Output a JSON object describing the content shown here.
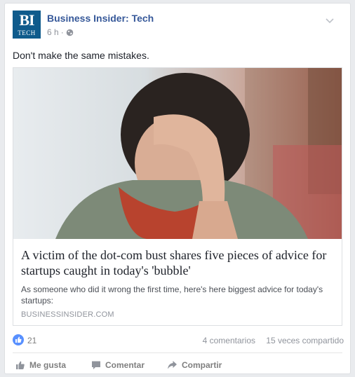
{
  "post": {
    "page_name": "Business Insider: Tech",
    "logo_text": "BI",
    "logo_subtext": "TECH",
    "time": "6 h",
    "separator": "·",
    "message": "Don't make the same mistakes."
  },
  "link": {
    "title": "A victim of the dot-com bust shares five pieces of advice for startups caught in today's 'bubble'",
    "description": "As someone who did it wrong the first time, here's here biggest advice for today's startups:",
    "domain": "BUSINESSINSIDER.COM"
  },
  "stats": {
    "likes": "21",
    "comments": "4 comentarios",
    "shares": "15 veces compartido"
  },
  "actions": {
    "like": "Me gusta",
    "comment": "Comentar",
    "share": "Compartir"
  },
  "colors": {
    "brand_blue": "#365899",
    "logo_bg": "#0f5b8c",
    "like_blue": "#5890ff"
  }
}
